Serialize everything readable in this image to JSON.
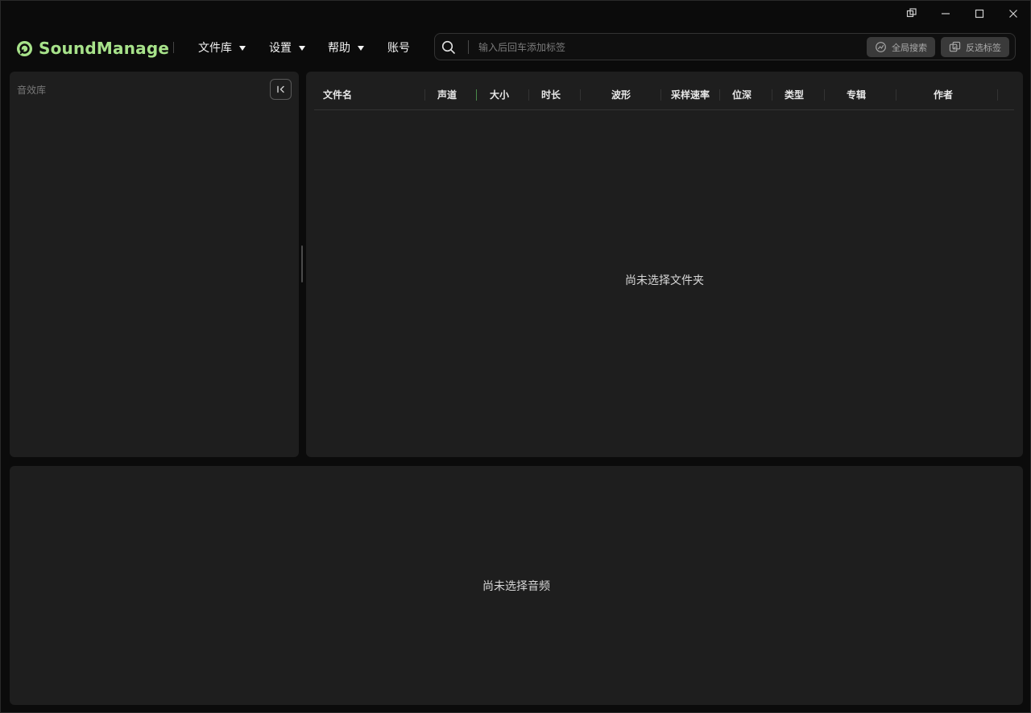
{
  "app": {
    "brand": "SoundManage",
    "brand_color": "#a7e28a"
  },
  "window_controls": [
    "restore-icon",
    "minimize-icon",
    "maximize-icon",
    "close-icon"
  ],
  "nav": {
    "library": "文件库",
    "settings": "设置",
    "help": "帮助",
    "account": "账号"
  },
  "search": {
    "placeholder": "输入后回车添加标签",
    "global_search": "全局搜索",
    "invert_tags": "反选标签"
  },
  "sidebar": {
    "title": "音效库"
  },
  "table": {
    "columns": [
      "文件名",
      "声道",
      "大小",
      "时长",
      "波形",
      "采样速率",
      "位深",
      "类型",
      "专辑",
      "作者"
    ],
    "empty": "尚未选择文件夹"
  },
  "player": {
    "empty": "尚未选择音频"
  }
}
